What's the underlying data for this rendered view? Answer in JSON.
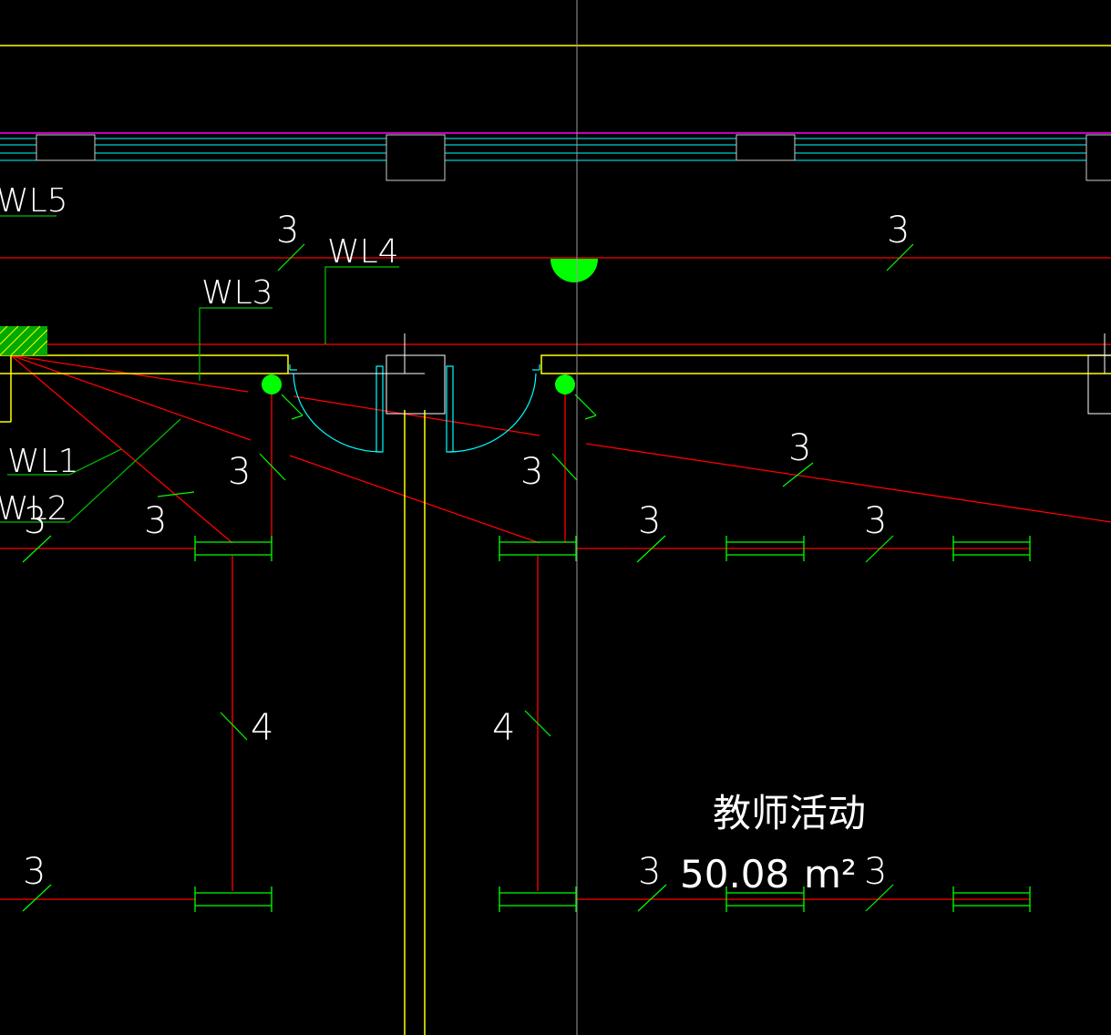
{
  "colors": {
    "background": "#000000",
    "wire": "#ff0000",
    "wall": "#ffff00",
    "window": "#00ffff",
    "beam": "#ff00ff",
    "fixture": "#00ff00",
    "leader": "#00c000",
    "text": "#ffffff",
    "crosshair": "#9a9a9a"
  },
  "circuit_labels": {
    "wl1": "WL1",
    "wl2": "WL2",
    "wl3": "WL3",
    "wl4": "WL4",
    "wl5": "WL5"
  },
  "wire_counts": {
    "c1": "3",
    "c2": "3",
    "c3": "3",
    "c4": "3",
    "c5": "3",
    "c6": "3",
    "c7": "3",
    "c8": "3",
    "c9": "3",
    "c10": "3",
    "c11": "3",
    "c12": "3",
    "c13": "4",
    "c14": "4"
  },
  "room": {
    "name": "教师活动",
    "area_value": "50.08",
    "area_unit": "m²"
  }
}
